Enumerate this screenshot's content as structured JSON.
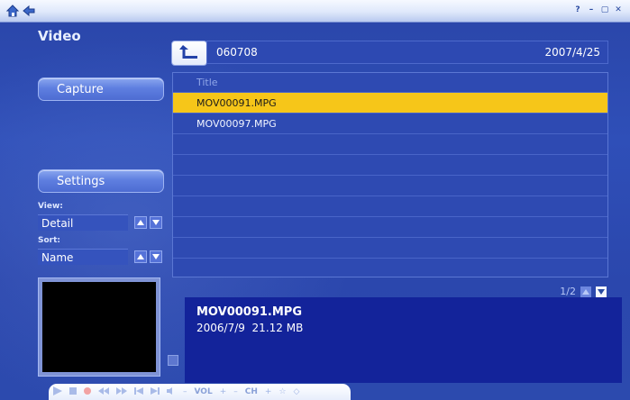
{
  "titlebar": {
    "home_icon": "home-icon",
    "back_icon": "back-arrow-icon",
    "controls": [
      "?",
      "–",
      "▢",
      "✕"
    ]
  },
  "sidebar": {
    "title": "Video",
    "capture_label": "Capture",
    "settings_label": "Settings",
    "view_label": "View:",
    "view_value": "Detail",
    "sort_label": "Sort:",
    "sort_value": "Name"
  },
  "pathbar": {
    "folder": "060708",
    "date": "2007/4/25"
  },
  "list": {
    "header": "Title",
    "items": [
      "MOV00091.MPG",
      "MOV00097.MPG"
    ],
    "selected_index": 0
  },
  "pager": {
    "text": "1/2"
  },
  "info": {
    "name": "MOV00091.MPG",
    "date": "2006/7/9",
    "size": "21.12 MB"
  },
  "mediabar": {
    "vol": "VOL",
    "ch": "CH"
  },
  "colors": {
    "background": "#2c4aae",
    "selected_row": "#f6c619",
    "info_panel": "#13239a"
  }
}
